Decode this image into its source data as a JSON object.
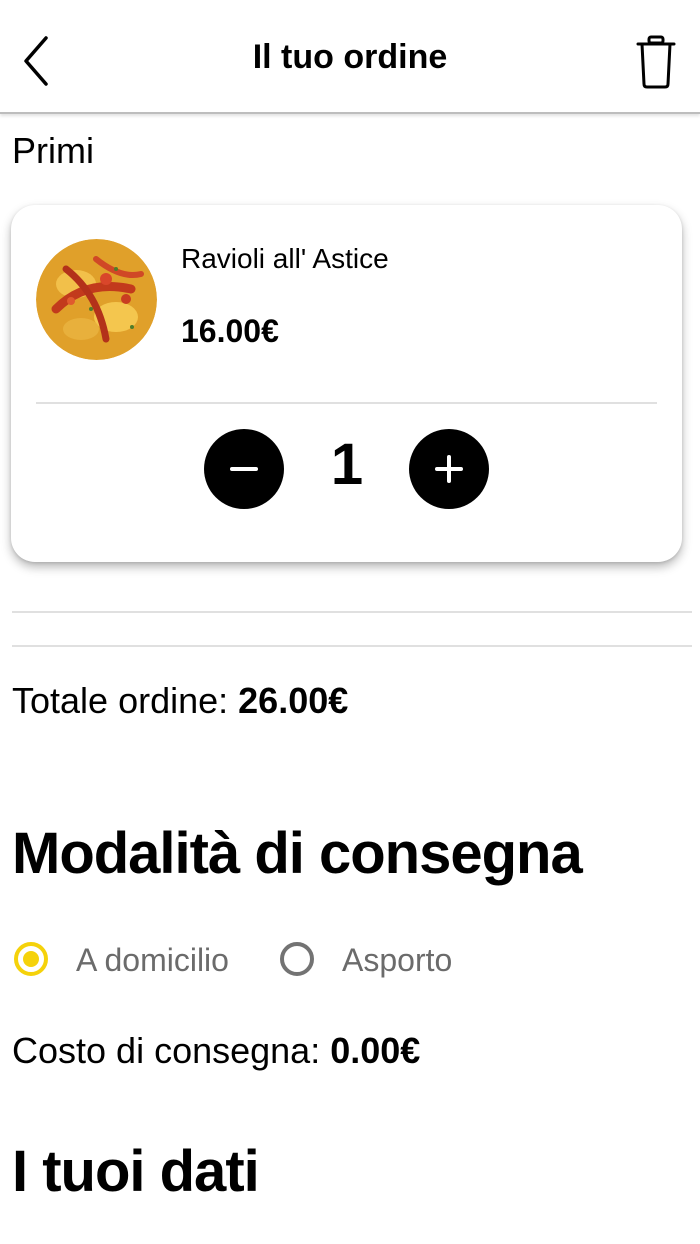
{
  "header": {
    "title": "Il tuo ordine",
    "back_icon": "chevron-left-icon",
    "delete_icon": "trash-icon"
  },
  "section": {
    "label": "Primi"
  },
  "item": {
    "name": "Ravioli all' Astice",
    "price": "16.00€",
    "quantity": "1",
    "image_icon": "dish-photo"
  },
  "summary": {
    "total_label": "Totale ordine: ",
    "total_value": "26.00€"
  },
  "delivery": {
    "heading": "Modalità di consegna",
    "options": [
      {
        "label": "A domicilio",
        "selected": true
      },
      {
        "label": "Asporto",
        "selected": false
      }
    ],
    "cost_label": "Costo di consegna: ",
    "cost_value": "0.00€"
  },
  "user_data": {
    "heading": "I tuoi dati"
  },
  "colors": {
    "accent": "#f5d20b",
    "radio_off": "#737373",
    "button": "#000000"
  }
}
